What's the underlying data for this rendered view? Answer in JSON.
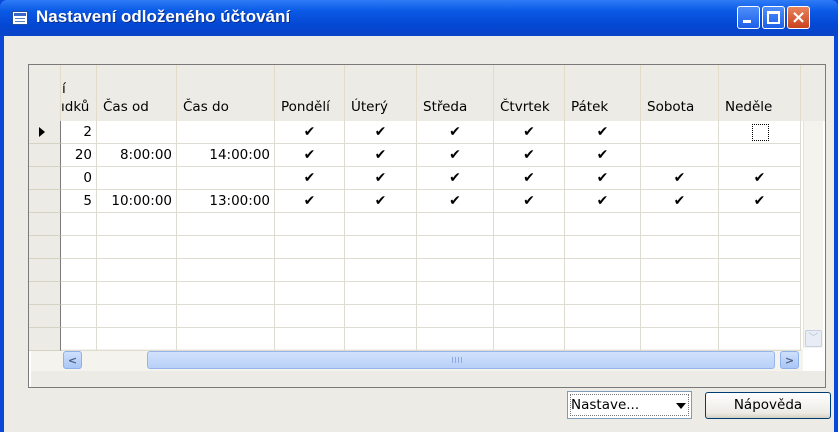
{
  "window": {
    "title": "Nastavení odloženého účtování",
    "controls": {
      "minimize": "minimize",
      "maximize": "maximize",
      "close": "×"
    }
  },
  "grid": {
    "columns": [
      {
        "key": "rows",
        "label_line1": "í",
        "label_line2": "ıdků"
      },
      {
        "key": "time_from",
        "label": "Čas od"
      },
      {
        "key": "time_to",
        "label": "Čas do"
      },
      {
        "key": "mon",
        "label": "Pondělí"
      },
      {
        "key": "tue",
        "label": "Úterý"
      },
      {
        "key": "wed",
        "label": "Středa"
      },
      {
        "key": "thu",
        "label": "Čtvrtek"
      },
      {
        "key": "fri",
        "label": "Pátek"
      },
      {
        "key": "sat",
        "label": "Sobota"
      },
      {
        "key": "sun",
        "label": "Neděle"
      }
    ],
    "check_mark": "✔",
    "rows": [
      {
        "rows": "2",
        "time_from": "",
        "time_to": "",
        "mon": true,
        "tue": true,
        "wed": true,
        "thu": true,
        "fri": true,
        "sat": false,
        "sun": false
      },
      {
        "rows": "20",
        "time_from": "8:00:00",
        "time_to": "14:00:00",
        "mon": true,
        "tue": true,
        "wed": true,
        "thu": true,
        "fri": true,
        "sat": false,
        "sun": false
      },
      {
        "rows": "0",
        "time_from": "",
        "time_to": "",
        "mon": true,
        "tue": true,
        "wed": true,
        "thu": true,
        "fri": true,
        "sat": true,
        "sun": true
      },
      {
        "rows": "5",
        "time_from": "10:00:00",
        "time_to": "13:00:00",
        "mon": true,
        "tue": true,
        "wed": true,
        "thu": true,
        "fri": true,
        "sat": true,
        "sun": true
      }
    ],
    "empty_rows": 6,
    "current_row": 0
  },
  "footer": {
    "combo_value": "Nastave...",
    "help_button": "Nápověda"
  },
  "colors": {
    "titlebar": "#0a5ae6",
    "client": "#ecebe5",
    "close_button": "#d9542a"
  }
}
